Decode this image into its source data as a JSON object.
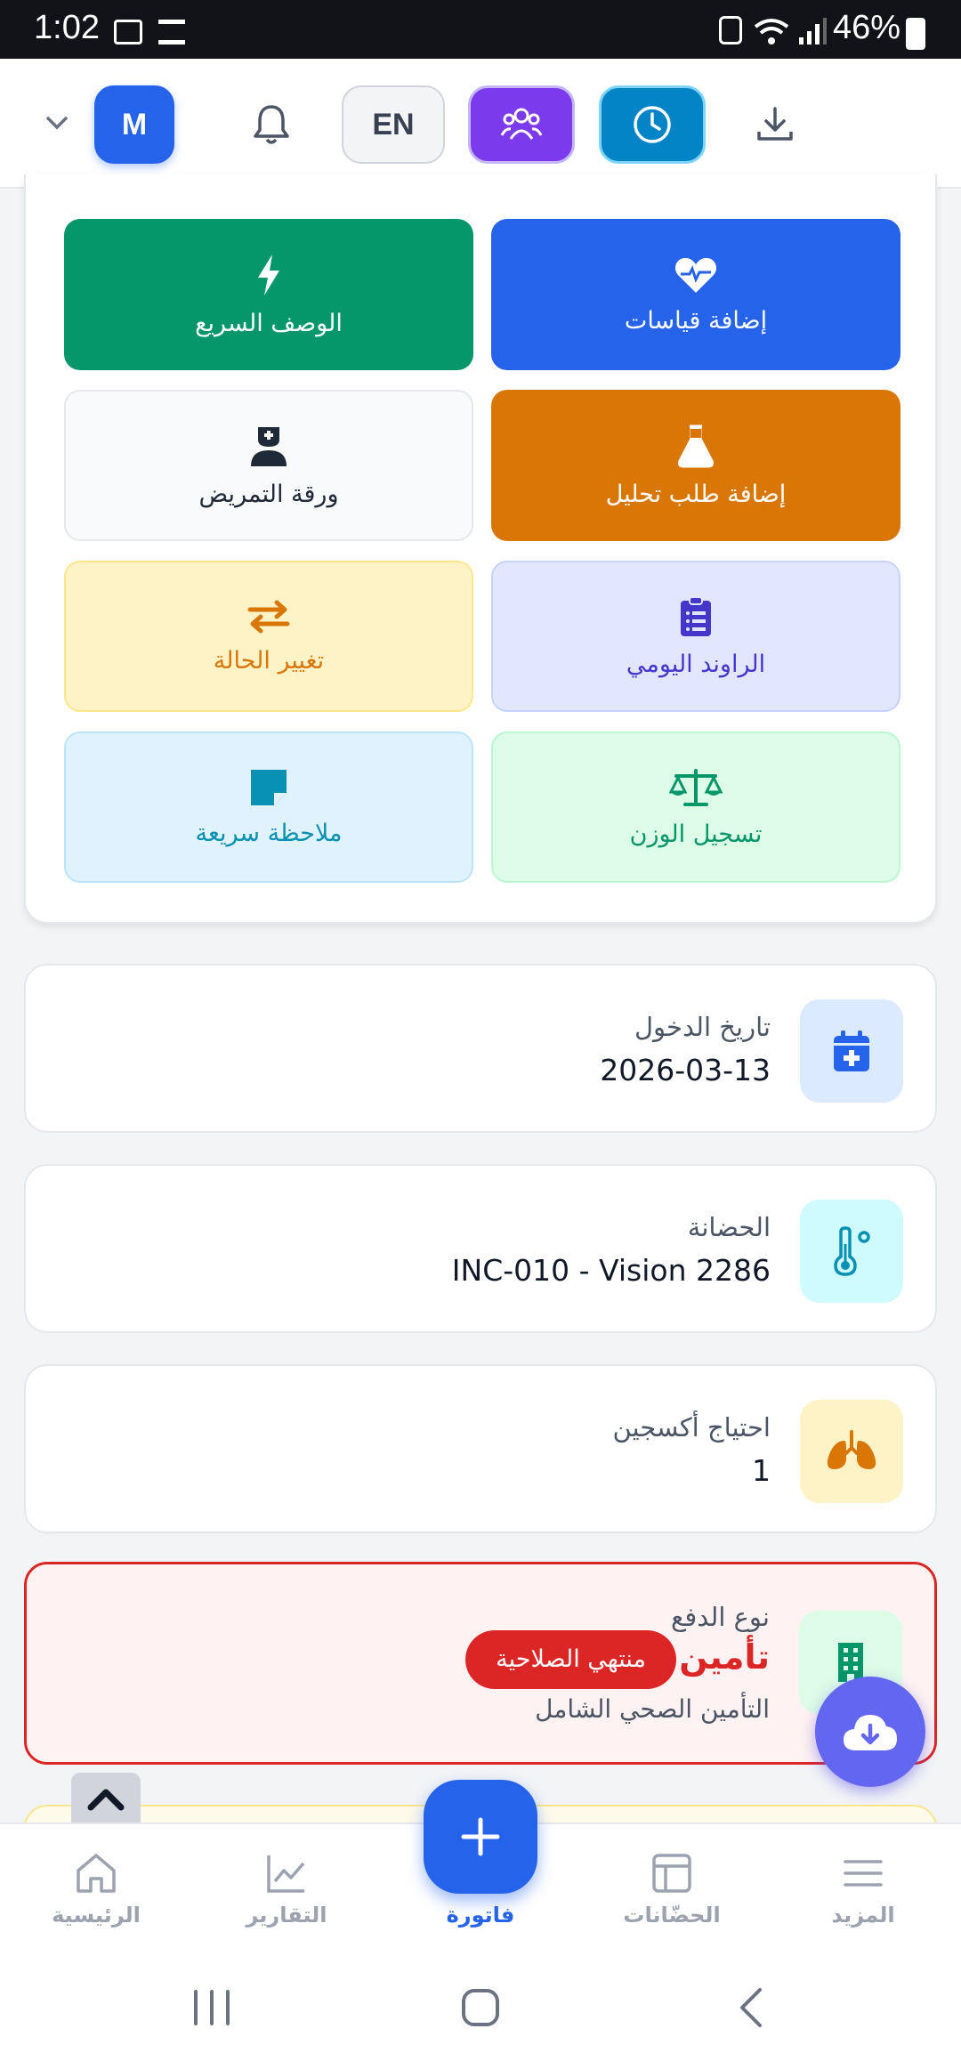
{
  "status_bar": {
    "time": "1:02",
    "battery": "46%"
  },
  "header": {
    "user_initial": "M",
    "language": "EN"
  },
  "quick_actions": [
    {
      "label": "إضافة قياسات",
      "icon": "heart-pulse-icon"
    },
    {
      "label": "الوصف السريع",
      "icon": "bolt-icon"
    },
    {
      "label": "إضافة طلب تحليل",
      "icon": "flask-icon"
    },
    {
      "label": "ورقة التمريض",
      "icon": "nurse-icon"
    },
    {
      "label": "الراوند اليومي",
      "icon": "clipboard-list-icon"
    },
    {
      "label": "تغيير الحالة",
      "icon": "swap-arrows-icon"
    },
    {
      "label": "تسجيل الوزن",
      "icon": "scale-icon"
    },
    {
      "label": "ملاحظة سريعة",
      "icon": "sticky-note-icon"
    }
  ],
  "info_cards": {
    "admission": {
      "label": "تاريخ الدخول",
      "value": "2026-03-13"
    },
    "incubator": {
      "label": "الحضانة",
      "value": "INC-010 - Vision 2286"
    },
    "oxygen": {
      "label": "احتياج أكسجين",
      "value": "1"
    },
    "payment": {
      "label": "نوع الدفع",
      "value": "تأمين",
      "badge": "منتهي الصلاحية",
      "provider": "التأمين الصحي الشامل"
    }
  },
  "bottom_nav": {
    "home": "الرئيسية",
    "reports": "التقارير",
    "invoice": "فاتورة",
    "incubators": "الحضّانات",
    "more": "المزيد"
  },
  "colors": {
    "primary": "#2563eb",
    "danger": "#dc2626",
    "accent_purple": "#7c3aed"
  }
}
